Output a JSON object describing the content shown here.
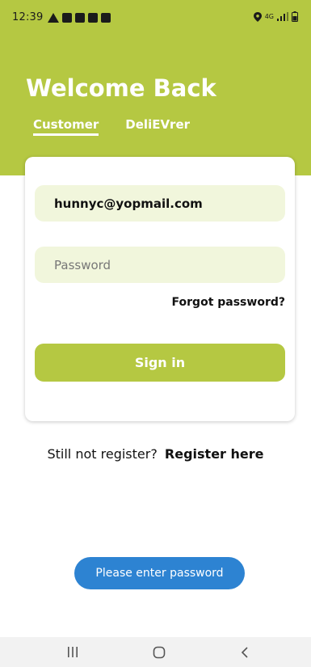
{
  "status_bar": {
    "time": "12:39",
    "network_label": "4G"
  },
  "header": {
    "title": "Welcome Back",
    "tabs": [
      {
        "label": "Customer",
        "active": true
      },
      {
        "label": "DeliEVrer",
        "active": false
      }
    ]
  },
  "form": {
    "email_value": "hunnyc@yopmail.com",
    "password_placeholder": "Password",
    "forgot_label": "Forgot password?",
    "signin_label": "Sign in"
  },
  "register": {
    "prompt": "Still not register?",
    "link_label": "Register here"
  },
  "toast": {
    "message": "Please enter password"
  },
  "colors": {
    "accent": "#b5c842",
    "field_bg": "#f1f6dc",
    "toast_bg": "#2d83d2"
  },
  "icons": {
    "status_left": [
      "warning-icon",
      "notification-icon",
      "check-icon",
      "image-icon",
      "wifi-icon"
    ],
    "status_right": [
      "location-icon",
      "signal-icon",
      "battery-icon"
    ],
    "navigation": [
      "recents-icon",
      "home-icon",
      "back-icon"
    ]
  }
}
